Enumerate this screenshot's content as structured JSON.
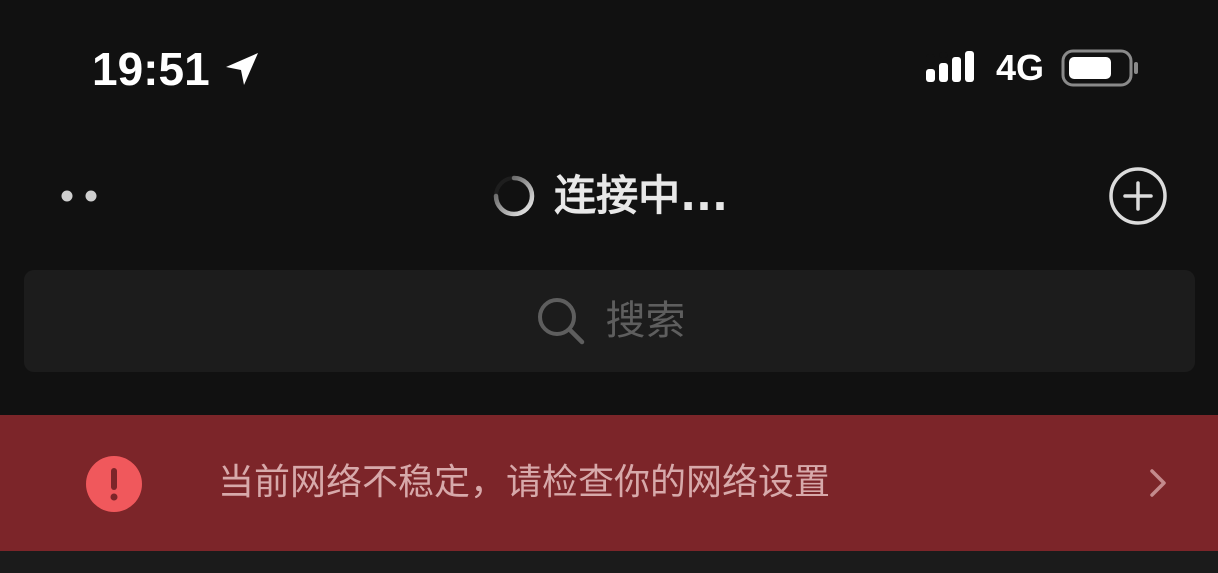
{
  "status_bar": {
    "time": "19:51",
    "network_type": "4G",
    "icons": [
      "location-arrow-icon",
      "signal-icon",
      "battery-icon"
    ]
  },
  "nav": {
    "title": "连接中...",
    "icons": [
      "more-icon",
      "spinner-icon",
      "add-circle-icon"
    ]
  },
  "search": {
    "placeholder": "搜索",
    "icon": "search-icon"
  },
  "banner": {
    "message": "当前网络不稳定，请检查你的网络设置",
    "icons": [
      "alert-icon",
      "chevron-right-icon"
    ]
  },
  "colors": {
    "background": "#111111",
    "search_bg": "#1c1c1c",
    "banner_bg": "#7c2529",
    "banner_text": "#d7a9aa",
    "alert_red": "#f0585c"
  }
}
